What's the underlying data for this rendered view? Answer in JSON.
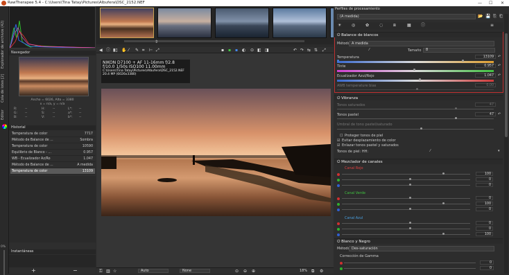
{
  "window": {
    "title": "RawTherapee 5.4 - C:\\Users\\Tina Tatay\\Pictures\\Albufera\\DSC_2152.NEF",
    "min": "—",
    "max": "☐",
    "close": "✕"
  },
  "vtabs": [
    "Explorador de archivos (42)",
    "Cola de lotes [2]",
    "Editor"
  ],
  "navigator": {
    "title": "Navegador",
    "size": "Ancho = 6026, Alto = 3380",
    "coords": "x = n/a, y = n/a",
    "r": "R:",
    "g": "G:",
    "b": "B:",
    "h": "H:",
    "s": "S:",
    "v": "V:",
    "l": "L*:",
    "a": "a*:",
    "bb": "b*:",
    "dash": "--"
  },
  "history": {
    "title": "Historial",
    "items": [
      {
        "name": "Temperatura de color",
        "value": "7717"
      },
      {
        "name": "Método de Balance de ...",
        "value": "Sombra"
      },
      {
        "name": "Temperatura de color",
        "value": "10590"
      },
      {
        "name": "Equilibrio de Blanco - ...",
        "value": "0.957"
      },
      {
        "name": "WB - Ecualizador Az/Ro",
        "value": "1.047"
      },
      {
        "name": "Método de Balance de ...",
        "value": "A medida"
      },
      {
        "name": "Temperatura de color",
        "value": "13109"
      }
    ]
  },
  "snapshots": {
    "title": "Instantáneas",
    "add": "+",
    "remove": "−"
  },
  "zoom_pct": "0%",
  "exif": {
    "line1": "NIKON D7100 + AF 11-16mm f/2.8",
    "line2": "f/10.0  1/50s  ISO100  11.00mm",
    "line3": "C:\\Users\\Tina Tatay\\Pictures\\Albufera\\DSC_2152.NEF",
    "line4": "20.4 MP (6026x3380)"
  },
  "bottom": {
    "mode": "Auto",
    "preset": "None",
    "zoom": "18%"
  },
  "right": {
    "title": "Perfiles de procesamiento",
    "profile": "(A medida)",
    "wb": {
      "section": "Balance de blancos",
      "method_label": "Método",
      "method": "A medida",
      "size_label": "Tamaño",
      "size": "8",
      "temp_label": "Temperatura",
      "temp": "13109",
      "tint_label": "Tinte",
      "tint": "0.957",
      "eq_label": "Ecualizador Azul/Rojo",
      "eq": "1.047",
      "bias_label": "AWB temperature bias",
      "bias": "0.00"
    },
    "vibrance": {
      "section": "Vibranza",
      "saturated_label": "Tonos saturados",
      "saturated": "47",
      "pastel_label": "Tonos pastel",
      "pastel": "47",
      "threshold_label": "Umbral de tono pastel/saturado",
      "protect": "Proteger tonos de piel",
      "avoid": "Evitar desplazamiento de color",
      "link": "Enlazar tonos pastel y saturados",
      "skin": "Tonos de piel: HH:"
    },
    "mixer": {
      "section": "Mezclador de canales",
      "red": "Canal Rojo",
      "green": "Canal Verde",
      "blue": "Canal Azul",
      "red_vals": [
        "100",
        "0",
        "0"
      ],
      "green_vals": [
        "0",
        "100",
        "0"
      ],
      "blue_vals": [
        "0",
        "0",
        "100"
      ]
    },
    "bw": {
      "section": "Blanco y Negro",
      "method_label": "Método:",
      "method": "Des-saturación",
      "gamma": "Corrección de Gamma",
      "g_vals": [
        "0",
        "0"
      ]
    }
  }
}
